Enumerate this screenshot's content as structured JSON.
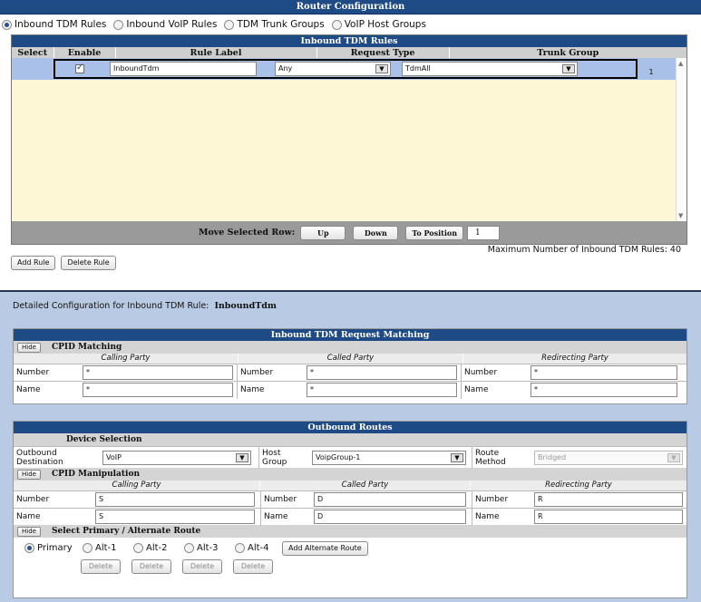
{
  "title": "Router Configuration",
  "tabs": [
    {
      "label": "Inbound TDM Rules",
      "selected": true
    },
    {
      "label": "Inbound VoIP Rules",
      "selected": false
    },
    {
      "label": "TDM Trunk Groups",
      "selected": false
    },
    {
      "label": "VoIP Host Groups",
      "selected": false
    }
  ],
  "rules_table": {
    "title": "Inbound TDM Rules",
    "columns": [
      "Select",
      "Enable",
      "Rule Label",
      "Request Type",
      "Trunk Group"
    ],
    "rows": [
      {
        "enabled": true,
        "label": "InboundTdm",
        "request_type": "Any",
        "trunk_group": "TdmAll",
        "index": "1"
      }
    ],
    "move_label": "Move Selected Row:",
    "up": "Up",
    "down": "Down",
    "to_position": "To Position",
    "position_value": "1",
    "max_text": "Maximum Number of Inbound TDM Rules: 40",
    "add_rule": "Add Rule",
    "delete_rule": "Delete Rule"
  },
  "detail": {
    "prefix": "Detailed Configuration for Inbound TDM Rule:",
    "rule_name": "InboundTdm"
  },
  "matching": {
    "title": "Inbound TDM Request Matching",
    "hide": "Hide",
    "section": "CPID Matching",
    "calling_party": "Calling Party",
    "called_party": "Called Party",
    "redirecting_party": "Redirecting Party",
    "number_label": "Number",
    "name_label": "Name",
    "calling_number": "*",
    "calling_name": "*",
    "called_number": "*",
    "called_name": "*",
    "redirect_number": "*",
    "redirect_name": "*"
  },
  "outbound": {
    "title": "Outbound Routes",
    "device_selection": "Device Selection",
    "dest_label_1": "Outbound",
    "dest_label_2": "Destination",
    "dest_value": "VoIP",
    "host_label_1": "Host",
    "host_label_2": "Group",
    "host_value": "VoipGroup-1",
    "route_label_1": "Route",
    "route_label_2": "Method",
    "route_value": "Bridged",
    "hide": "Hide",
    "cpid_manipulation": "CPID Manipulation",
    "calling_party": "Calling Party",
    "called_party": "Called Party",
    "redirecting_party": "Redirecting Party",
    "number_label": "Number",
    "name_label": "Name",
    "calling_number": "S",
    "calling_name": "S",
    "called_number": "D",
    "called_name": "D",
    "redirect_number": "R",
    "redirect_name": "R",
    "select_route": "Select Primary / Alternate Route",
    "routes": [
      {
        "label": "Primary",
        "selected": true
      },
      {
        "label": "Alt-1",
        "selected": false
      },
      {
        "label": "Alt-2",
        "selected": false
      },
      {
        "label": "Alt-3",
        "selected": false
      },
      {
        "label": "Alt-4",
        "selected": false
      }
    ],
    "delete": "Delete",
    "add_alternate": "Add Alternate Route"
  }
}
